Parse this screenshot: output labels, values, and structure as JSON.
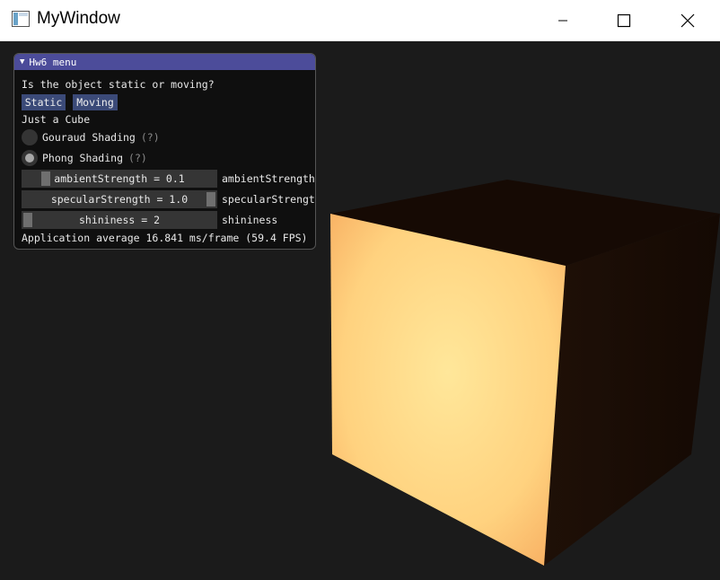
{
  "window": {
    "title": "MyWindow",
    "controls": {
      "minimize": "minimize-icon",
      "maximize": "maximize-icon",
      "close": "close-icon"
    }
  },
  "scene": {
    "background_color": "#1b1b1b",
    "object": "cube"
  },
  "panel": {
    "title": "Hw6 menu",
    "question": "Is the object static or moving?",
    "buttons": {
      "static": "Static",
      "moving": "Moving"
    },
    "object_label": "Just a Cube",
    "shading": {
      "gouraud": "Gouraud Shading",
      "phong": "Phong Shading",
      "help": "(?)",
      "selected": "Phong Shading"
    },
    "sliders": [
      {
        "value_text": "ambientStrength = 0.1",
        "label": "ambientStrength",
        "fraction": 0.1
      },
      {
        "value_text": "specularStrength = 1.0",
        "label": "specularStrengt",
        "fraction": 1.0
      },
      {
        "value_text": "shininess = 2",
        "label": "shininess",
        "fraction": 0.0
      }
    ],
    "stats": "Application average 16.841 ms/frame (59.4 FPS)"
  },
  "colors": {
    "panel_header": "#4c4c9a",
    "button": "#3b4a78",
    "cube_front": "#ffd27f",
    "cube_side": "#1a0d05"
  }
}
